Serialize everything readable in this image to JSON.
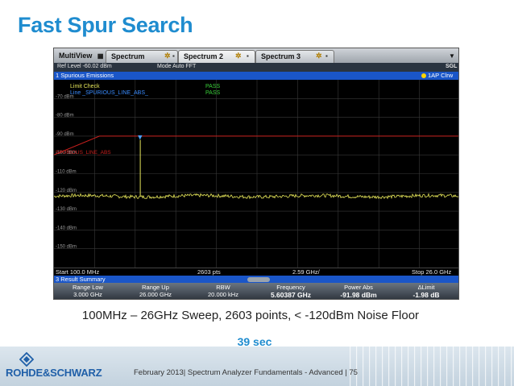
{
  "slide": {
    "title": "Fast Spur Search",
    "caption": "100MHz – 26GHz Sweep, 2603 points, < -120dBm Noise Floor",
    "duration": "39 sec",
    "footer": "February 2013| Spectrum Analyzer Fundamentals - Advanced | 75",
    "logo_text": "ROHDE&SCHWARZ"
  },
  "analyzer": {
    "tabs": [
      {
        "label": "MultiView"
      },
      {
        "label": "Spectrum"
      },
      {
        "label": "Spectrum 2"
      },
      {
        "label": "Spectrum 3"
      }
    ],
    "sgl": "SGL",
    "ref_level": "Ref Level -60.02 dBm",
    "mode": "Mode Auto FFT",
    "window_title": "1 Spurious Emissions",
    "trace_label": "1AP Clrw",
    "limit_check_label": "Limit Check",
    "limit_check_result": "PASS",
    "line_label": "Line _SPURIOUS_LINE_ABS_",
    "line_result": "PASS",
    "limit_line_name": "SPURIOUS_LINE_ABS",
    "y_ticks": [
      "-70 dBm",
      "-80 dBm",
      "-90 dBm",
      "-100 dBm",
      "-110 dBm",
      "-120 dBm",
      "-130 dBm",
      "-140 dBm",
      "-150 dBm"
    ],
    "start": "Start 100.0 MHz",
    "points": "2603 pts",
    "center": "2.59 GHz/",
    "stop": "Stop 26.0 GHz",
    "result_summary_title": "3 Result Summary",
    "result_headers": [
      "Range Low",
      "Range Up",
      "RBW",
      "Frequency",
      "Power Abs",
      "ΔLimit"
    ],
    "result_values": [
      "3.000 GHz",
      "26.000 GHz",
      "20.000 kHz",
      "5.60387 GHz",
      "-91.98 dBm",
      "-1.98 dB"
    ]
  },
  "chart_data": {
    "type": "line",
    "y_range_dbm": [
      -160,
      -60
    ],
    "x_range_ghz": [
      0.1,
      26.0
    ],
    "noise_floor_dbm": -122,
    "spur": {
      "frequency_ghz": 5.60387,
      "power_dbm": -91.98
    },
    "limit_line_dbm": [
      {
        "x_ghz": 0.1,
        "y_dbm": -100
      },
      {
        "x_ghz": 3.0,
        "y_dbm": -90
      },
      {
        "x_ghz": 26.0,
        "y_dbm": -90
      }
    ],
    "colors": {
      "trace": "#e6e65a",
      "limit": "#c8201e",
      "marker": "#4aa3ff"
    }
  }
}
